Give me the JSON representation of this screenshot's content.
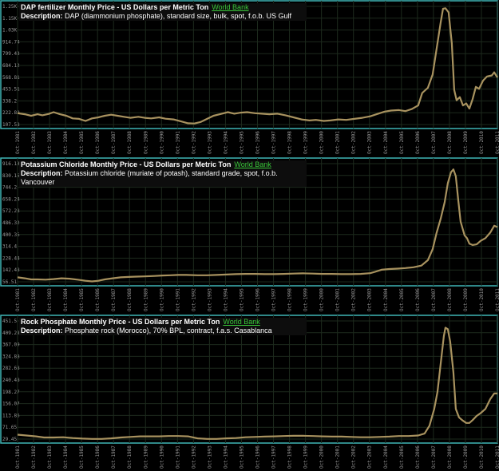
{
  "source_link": "World Bank",
  "description_label": "Description:",
  "colors": {
    "line": "#a8925f",
    "frame": "#3fb6b6",
    "grid": "#1d2a1d",
    "text": "#9a9a9a"
  },
  "x_tick_labels": [
    "Oct-1981",
    "Oct-1982",
    "Oct-1983",
    "Oct-1984",
    "Oct-1985",
    "Oct-1986",
    "Oct-1987",
    "Oct-1988",
    "Oct-1989",
    "Oct-1990",
    "Oct-1991",
    "Oct-1992",
    "Oct-1993",
    "Oct-1994",
    "Oct-1995",
    "Oct-1996",
    "Oct-1997",
    "Oct-1998",
    "Oct-1999",
    "Oct-2000",
    "Oct-2001",
    "Oct-2002",
    "Oct-2003",
    "Oct-2004",
    "Oct-2005",
    "Oct-2006",
    "Oct-2007",
    "Oct-2008",
    "Oct-2009",
    "Oct-2010",
    "Oct-2011"
  ],
  "chart_data": [
    {
      "type": "line",
      "title": "DAP fertilizer Monthly Price - US Dollars per Metric Ton",
      "description": "DAP (diammonium phosphate), standard size, bulk, spot, f.o.b. US Gulf",
      "y_ticks": [
        "1.25K",
        "1.15K",
        "1.03K",
        "914.74",
        "799.43",
        "684.12",
        "568.81",
        "453.51",
        "338.2",
        "222.89",
        "107.58"
      ],
      "ylim": [
        107.58,
        1250
      ],
      "xlim": [
        1981.75,
        2011.75
      ],
      "series": [
        {
          "points": [
            [
              1981.75,
              225
            ],
            [
              1982.2,
              215
            ],
            [
              1982.6,
              200
            ],
            [
              1983.0,
              215
            ],
            [
              1983.3,
              205
            ],
            [
              1983.7,
              218
            ],
            [
              1984.0,
              235
            ],
            [
              1984.4,
              215
            ],
            [
              1984.8,
              200
            ],
            [
              1985.2,
              175
            ],
            [
              1985.6,
              170
            ],
            [
              1986.0,
              150
            ],
            [
              1986.4,
              175
            ],
            [
              1986.8,
              185
            ],
            [
              1987.2,
              200
            ],
            [
              1987.6,
              210
            ],
            [
              1988.0,
              200
            ],
            [
              1988.4,
              190
            ],
            [
              1988.8,
              180
            ],
            [
              1989.3,
              190
            ],
            [
              1989.7,
              180
            ],
            [
              1990.1,
              175
            ],
            [
              1990.6,
              185
            ],
            [
              1991.0,
              172
            ],
            [
              1991.5,
              165
            ],
            [
              1992.0,
              145
            ],
            [
              1992.4,
              128
            ],
            [
              1992.8,
              125
            ],
            [
              1993.2,
              140
            ],
            [
              1993.6,
              170
            ],
            [
              1994.0,
              200
            ],
            [
              1994.4,
              215
            ],
            [
              1994.9,
              235
            ],
            [
              1995.3,
              220
            ],
            [
              1995.7,
              230
            ],
            [
              1996.1,
              235
            ],
            [
              1996.6,
              225
            ],
            [
              1997.0,
              220
            ],
            [
              1997.5,
              215
            ],
            [
              1998.0,
              220
            ],
            [
              1998.5,
              205
            ],
            [
              1999.0,
              185
            ],
            [
              1999.5,
              165
            ],
            [
              2000.0,
              155
            ],
            [
              2000.4,
              160
            ],
            [
              2000.9,
              150
            ],
            [
              2001.3,
              155
            ],
            [
              2001.8,
              165
            ],
            [
              2002.3,
              160
            ],
            [
              2002.8,
              170
            ],
            [
              2003.3,
              180
            ],
            [
              2003.8,
              195
            ],
            [
              2004.2,
              215
            ],
            [
              2004.7,
              240
            ],
            [
              2005.1,
              250
            ],
            [
              2005.6,
              255
            ],
            [
              2006.0,
              245
            ],
            [
              2006.4,
              265
            ],
            [
              2006.8,
              300
            ],
            [
              2007.05,
              420
            ],
            [
              2007.4,
              470
            ],
            [
              2007.7,
              600
            ],
            [
              2007.95,
              850
            ],
            [
              2008.2,
              1100
            ],
            [
              2008.35,
              1235
            ],
            [
              2008.5,
              1240
            ],
            [
              2008.7,
              1200
            ],
            [
              2008.9,
              900
            ],
            [
              2009.05,
              450
            ],
            [
              2009.2,
              350
            ],
            [
              2009.4,
              380
            ],
            [
              2009.6,
              300
            ],
            [
              2009.8,
              320
            ],
            [
              2010.0,
              270
            ],
            [
              2010.2,
              360
            ],
            [
              2010.4,
              480
            ],
            [
              2010.6,
              460
            ],
            [
              2010.85,
              540
            ],
            [
              2011.1,
              580
            ],
            [
              2011.4,
              590
            ],
            [
              2011.55,
              620
            ],
            [
              2011.75,
              570
            ]
          ]
        }
      ]
    },
    {
      "type": "line",
      "title": "Potassium Chloride Monthly Price - US Dollars per Metric Ton",
      "description": "Potassium chloride (muriate of potash), standard grade, spot, f.o.b. Vancouver",
      "y_ticks": [
        "916.13",
        "830.16",
        "744.2",
        "658.24",
        "572.28",
        "486.32",
        "400.36",
        "314.4",
        "228.44",
        "142.48",
        "56.51"
      ],
      "ylim": [
        56.51,
        916.13
      ],
      "xlim": [
        1981.75,
        2011.75
      ],
      "series": [
        {
          "points": [
            [
              1981.75,
              95
            ],
            [
              1982.2,
              88
            ],
            [
              1982.6,
              80
            ],
            [
              1983.0,
              80
            ],
            [
              1983.5,
              78
            ],
            [
              1984.0,
              82
            ],
            [
              1984.5,
              88
            ],
            [
              1985.0,
              85
            ],
            [
              1985.5,
              78
            ],
            [
              1986.0,
              70
            ],
            [
              1986.4,
              65
            ],
            [
              1986.8,
              70
            ],
            [
              1987.2,
              80
            ],
            [
              1987.7,
              88
            ],
            [
              1988.2,
              95
            ],
            [
              1988.7,
              98
            ],
            [
              1989.2,
              100
            ],
            [
              1989.7,
              102
            ],
            [
              1990.3,
              105
            ],
            [
              1990.8,
              108
            ],
            [
              1991.3,
              110
            ],
            [
              1991.8,
              112
            ],
            [
              1992.3,
              112
            ],
            [
              1993.0,
              110
            ],
            [
              1993.6,
              110
            ],
            [
              1994.2,
              112
            ],
            [
              1994.8,
              115
            ],
            [
              1995.4,
              118
            ],
            [
              1996.0,
              120
            ],
            [
              1996.6,
              120
            ],
            [
              1997.2,
              118
            ],
            [
              1997.8,
              118
            ],
            [
              1998.4,
              120
            ],
            [
              1999.0,
              122
            ],
            [
              1999.6,
              124
            ],
            [
              2000.2,
              122
            ],
            [
              2000.8,
              120
            ],
            [
              2001.4,
              120
            ],
            [
              2002.0,
              118
            ],
            [
              2002.6,
              118
            ],
            [
              2003.2,
              120
            ],
            [
              2003.8,
              125
            ],
            [
              2004.1,
              135
            ],
            [
              2004.5,
              150
            ],
            [
              2005.0,
              155
            ],
            [
              2005.5,
              158
            ],
            [
              2006.0,
              162
            ],
            [
              2006.5,
              168
            ],
            [
              2007.0,
              180
            ],
            [
              2007.4,
              220
            ],
            [
              2007.7,
              300
            ],
            [
              2007.95,
              420
            ],
            [
              2008.2,
              520
            ],
            [
              2008.45,
              640
            ],
            [
              2008.65,
              780
            ],
            [
              2008.85,
              860
            ],
            [
              2009.0,
              880
            ],
            [
              2009.15,
              830
            ],
            [
              2009.3,
              660
            ],
            [
              2009.45,
              500
            ],
            [
              2009.55,
              460
            ],
            [
              2009.7,
              400
            ],
            [
              2009.85,
              380
            ],
            [
              2010.0,
              340
            ],
            [
              2010.2,
              330
            ],
            [
              2010.45,
              335
            ],
            [
              2010.7,
              360
            ],
            [
              2011.0,
              380
            ],
            [
              2011.3,
              420
            ],
            [
              2011.55,
              470
            ],
            [
              2011.75,
              460
            ]
          ]
        }
      ]
    },
    {
      "type": "line",
      "title": "Rock Phosphate Monthly Price - US Dollars per Metric Ton",
      "description": "Phosphate rock (Morocco), 70% BPL, contract, f.a.s. Casablanca",
      "y_ticks": [
        "451.5",
        "409.29",
        "367.09",
        "324.88",
        "282.68",
        "240.48",
        "198.27",
        "156.07",
        "113.86",
        "71.65",
        "29.45"
      ],
      "ylim": [
        29.45,
        451.5
      ],
      "xlim": [
        1981.75,
        2011.75
      ],
      "series": [
        {
          "points": [
            [
              1981.75,
              48
            ],
            [
              1982.3,
              45
            ],
            [
              1982.9,
              42
            ],
            [
              1983.4,
              38
            ],
            [
              1984.0,
              38
            ],
            [
              1984.6,
              39
            ],
            [
              1985.2,
              36
            ],
            [
              1985.8,
              34
            ],
            [
              1986.4,
              33
            ],
            [
              1987.0,
              33
            ],
            [
              1987.6,
              35
            ],
            [
              1988.2,
              38
            ],
            [
              1988.8,
              40
            ],
            [
              1989.4,
              42
            ],
            [
              1990.0,
              42
            ],
            [
              1990.6,
              42
            ],
            [
              1991.2,
              43
            ],
            [
              1991.8,
              43
            ],
            [
              1992.4,
              42
            ],
            [
              1993.0,
              35
            ],
            [
              1993.6,
              33
            ],
            [
              1994.2,
              33
            ],
            [
              1994.8,
              35
            ],
            [
              1995.4,
              36
            ],
            [
              1996.0,
              39
            ],
            [
              1996.6,
              40
            ],
            [
              1997.2,
              41
            ],
            [
              1997.8,
              42
            ],
            [
              1998.4,
              43
            ],
            [
              1999.0,
              44
            ],
            [
              1999.6,
              44
            ],
            [
              2000.2,
              43
            ],
            [
              2000.8,
              42
            ],
            [
              2001.4,
              41
            ],
            [
              2002.0,
              41
            ],
            [
              2002.6,
              40
            ],
            [
              2003.2,
              39
            ],
            [
              2003.8,
              39
            ],
            [
              2004.4,
              40
            ],
            [
              2005.0,
              41
            ],
            [
              2005.6,
              43
            ],
            [
              2006.2,
              43
            ],
            [
              2006.8,
              45
            ],
            [
              2007.2,
              52
            ],
            [
              2007.5,
              80
            ],
            [
              2007.8,
              140
            ],
            [
              2008.0,
              200
            ],
            [
              2008.2,
              300
            ],
            [
              2008.4,
              400
            ],
            [
              2008.5,
              430
            ],
            [
              2008.65,
              425
            ],
            [
              2008.8,
              380
            ],
            [
              2009.0,
              270
            ],
            [
              2009.15,
              140
            ],
            [
              2009.35,
              110
            ],
            [
              2009.55,
              100
            ],
            [
              2009.8,
              90
            ],
            [
              2010.0,
              90
            ],
            [
              2010.2,
              100
            ],
            [
              2010.45,
              115
            ],
            [
              2010.7,
              125
            ],
            [
              2011.0,
              140
            ],
            [
              2011.3,
              175
            ],
            [
              2011.55,
              195
            ],
            [
              2011.75,
              195
            ]
          ]
        }
      ]
    }
  ]
}
